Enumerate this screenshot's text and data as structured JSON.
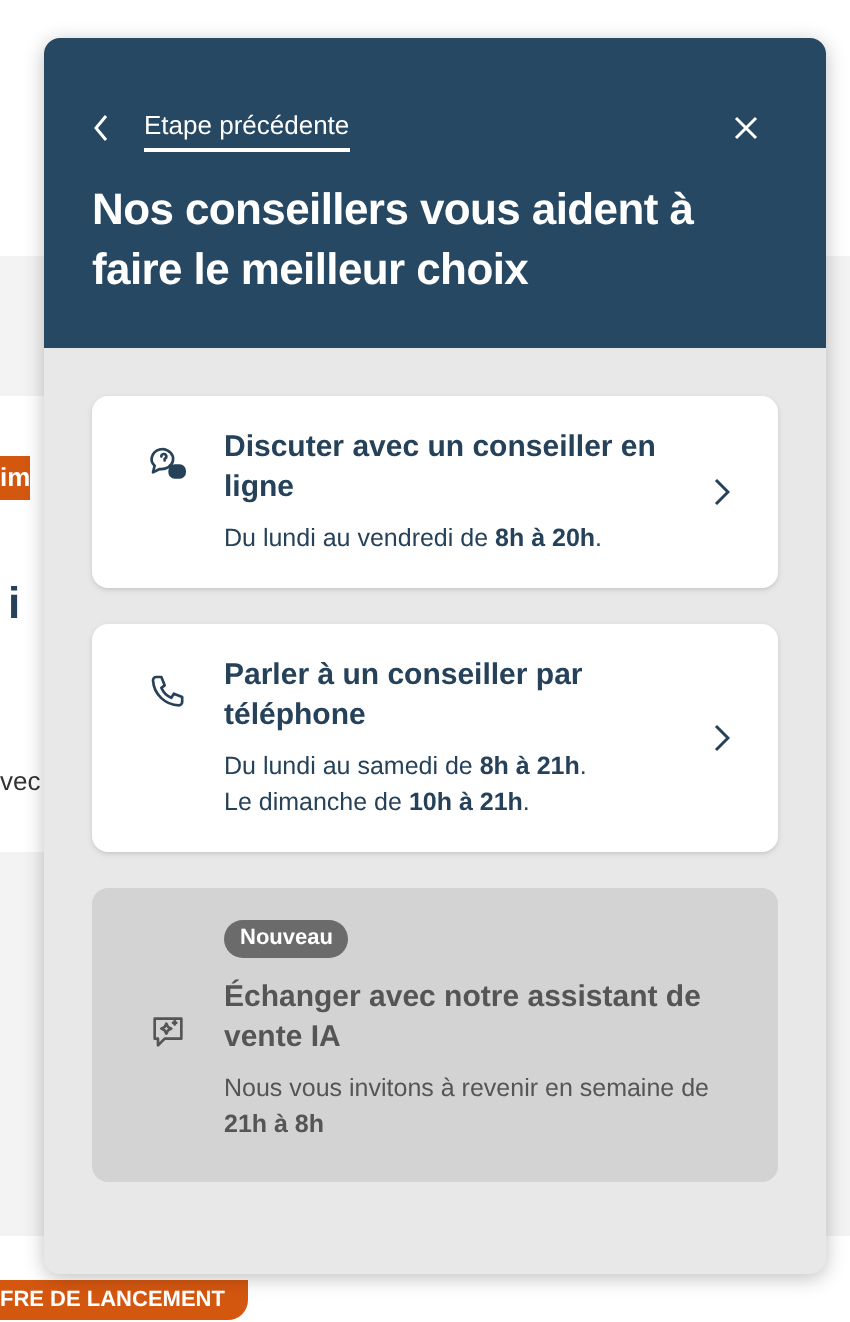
{
  "background": {
    "tag": "im",
    "heading": "i",
    "text": "vec",
    "offer_badge": "FRE DE LANCEMENT"
  },
  "panel": {
    "back_link": "Etape précédente",
    "title": "Nos conseillers vous aident à faire le meilleur choix",
    "options": [
      {
        "kind": "chat",
        "title": "Discuter avec un conseiller en ligne",
        "lines": [
          "Du lundi au vendredi de **8h à 20h**."
        ],
        "disabled": false
      },
      {
        "kind": "phone",
        "title": "Parler à un conseiller par téléphone",
        "lines": [
          "Du lundi au samedi de **8h à 21h**.",
          "Le dimanche de **10h à 21h**."
        ],
        "disabled": false
      },
      {
        "kind": "ai",
        "badge": "Nouveau",
        "title": "Échanger avec notre assistant de vente IA",
        "lines": [
          "Nous vous invitons à revenir en semaine de **21h à 8h**"
        ],
        "disabled": true
      }
    ]
  }
}
